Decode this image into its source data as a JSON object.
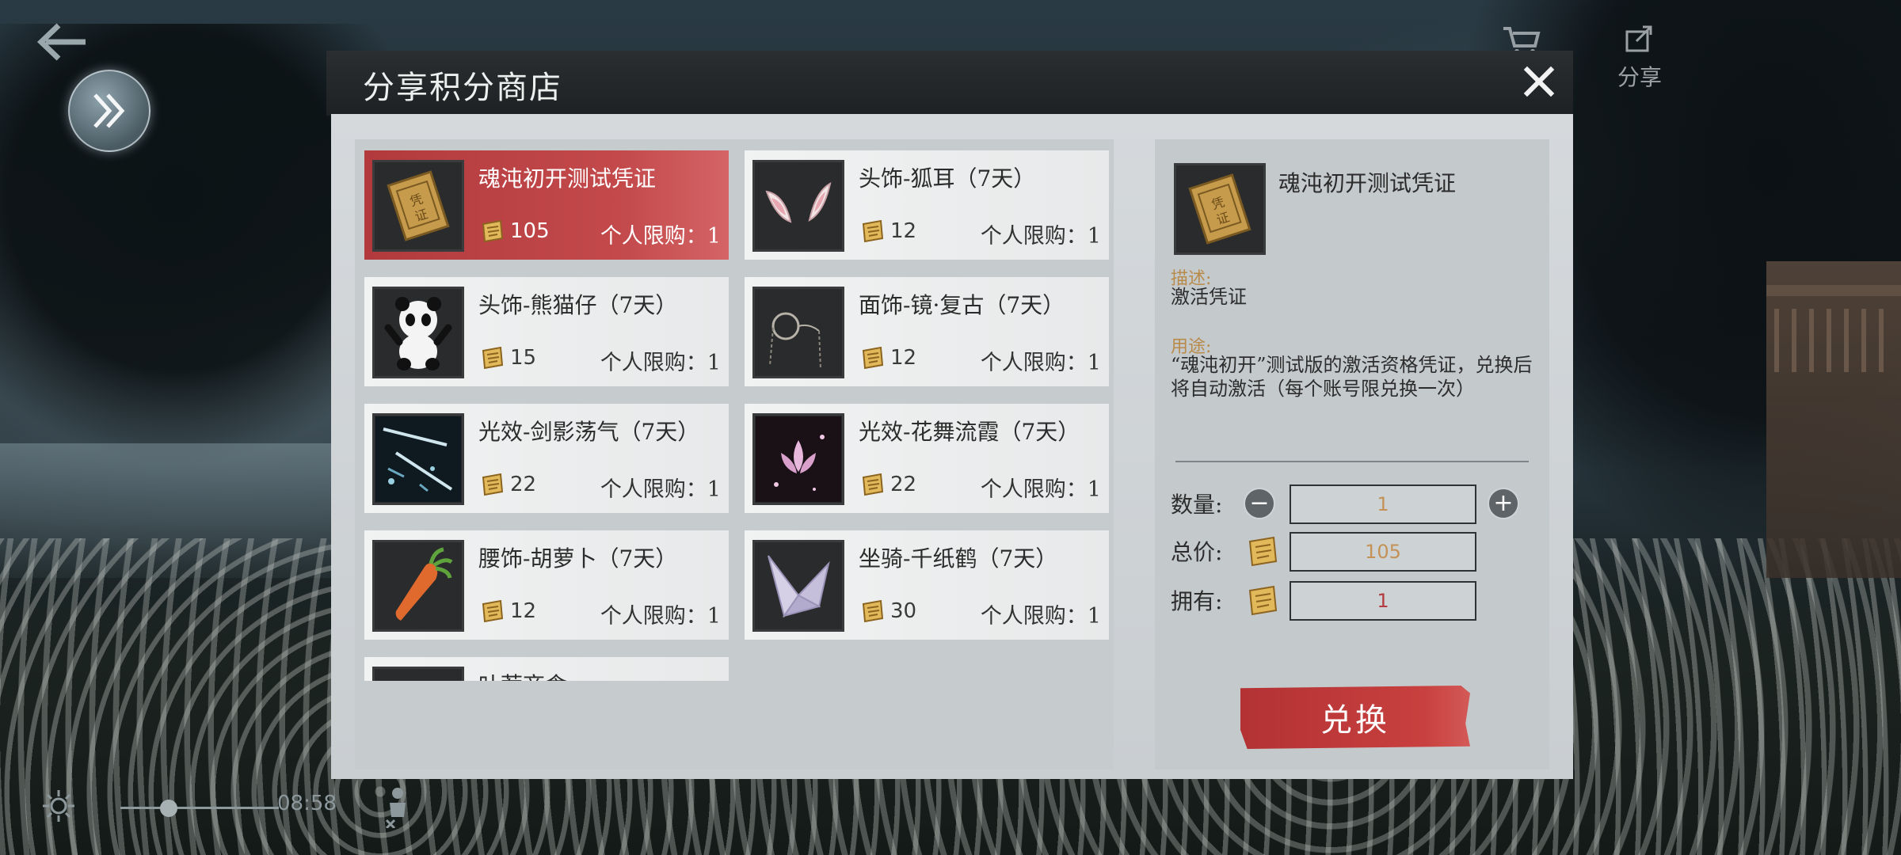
{
  "hud": {
    "share_label": "分享",
    "time": "08:58"
  },
  "dialog": {
    "title": "分享积分商店"
  },
  "items": [
    {
      "name": "魂沌初开测试凭证",
      "price": "105",
      "limit": "个人限购：1",
      "icon": "voucher-icon",
      "selected": true
    },
    {
      "name": "头饰-狐耳（7天）",
      "price": "12",
      "limit": "个人限购：1",
      "icon": "fox-ears-icon"
    },
    {
      "name": "头饰-熊猫仔（7天）",
      "price": "15",
      "limit": "个人限购：1",
      "icon": "panda-icon"
    },
    {
      "name": "面饰-镜·复古（7天）",
      "price": "12",
      "limit": "个人限购：1",
      "icon": "monocle-icon"
    },
    {
      "name": "光效-剑影荡气（7天）",
      "price": "22",
      "limit": "个人限购：1",
      "icon": "sword-light-icon"
    },
    {
      "name": "光效-花舞流霞（7天）",
      "price": "22",
      "limit": "个人限购：1",
      "icon": "lotus-light-icon"
    },
    {
      "name": "腰饰-胡萝卜（7天）",
      "price": "12",
      "limit": "个人限购：1",
      "icon": "carrot-icon"
    },
    {
      "name": "坐骑-千纸鹤（7天）",
      "price": "30",
      "limit": "个人限购：1",
      "icon": "paper-crane-icon"
    },
    {
      "name": "叶荐商食",
      "price": "",
      "limit": "",
      "icon": "item-icon"
    }
  ],
  "detail": {
    "name": "魂沌初开测试凭证",
    "desc_label": "描述:",
    "desc": "激活凭证",
    "usage_label": "用途:",
    "usage": "“魂沌初开”测试版的激活资格凭证，兑换后将自动激活（每个账号限兑换一次）",
    "qty_label": "数量:",
    "qty": "1",
    "total_label": "总价:",
    "total": "105",
    "owned_label": "拥有:",
    "owned": "1",
    "exchange_label": "兑换"
  },
  "colors": {
    "accent_red": "#c3494b",
    "gold_text": "#c49257",
    "header_bg": "#232628"
  }
}
